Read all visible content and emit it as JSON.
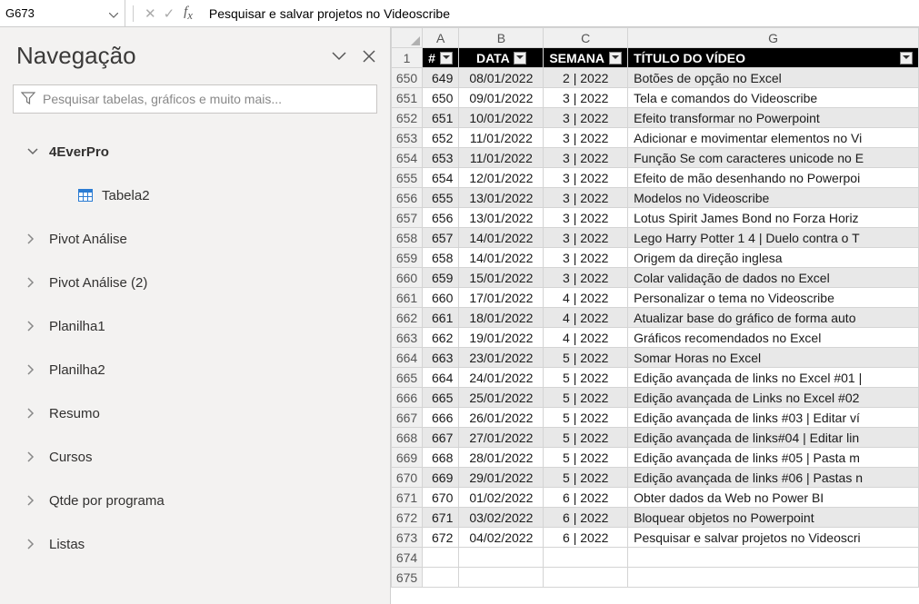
{
  "formula_bar": {
    "cell_ref": "G673",
    "formula": "Pesquisar e salvar projetos no Videoscribe"
  },
  "nav": {
    "title": "Navegação",
    "search_placeholder": "Pesquisar tabelas, gráficos e muito mais...",
    "tree": [
      {
        "label": "4EverPro",
        "bold": true,
        "expanded": true,
        "children": [
          {
            "label": "Tabela2",
            "icon": "table"
          }
        ]
      },
      {
        "label": "Pivot Análise",
        "bold": false,
        "expanded": false
      },
      {
        "label": "Pivot Análise (2)",
        "bold": false,
        "expanded": false
      },
      {
        "label": "Planilha1",
        "bold": false,
        "expanded": false
      },
      {
        "label": "Planilha2",
        "bold": false,
        "expanded": false
      },
      {
        "label": "Resumo",
        "bold": false,
        "expanded": false
      },
      {
        "label": "Cursos",
        "bold": false,
        "expanded": false
      },
      {
        "label": "Qtde por programa",
        "bold": false,
        "expanded": false
      },
      {
        "label": "Listas",
        "bold": false,
        "expanded": false
      }
    ]
  },
  "sheet": {
    "col_letters": [
      "A",
      "B",
      "C",
      "G"
    ],
    "header_row_num": "1",
    "headers": {
      "num": "#",
      "data": "DATA",
      "semana": "SEMANA",
      "titulo": "TÍTULO DO VÍDEO"
    },
    "rows": [
      {
        "r": "650",
        "n": "649",
        "d": "08/01/2022",
        "s": "2 | 2022",
        "t": "Botões de opção no Excel"
      },
      {
        "r": "651",
        "n": "650",
        "d": "09/01/2022",
        "s": "3 | 2022",
        "t": "Tela e comandos do Videoscribe"
      },
      {
        "r": "652",
        "n": "651",
        "d": "10/01/2022",
        "s": "3 | 2022",
        "t": "Efeito transformar no Powerpoint"
      },
      {
        "r": "653",
        "n": "652",
        "d": "11/01/2022",
        "s": "3 | 2022",
        "t": "Adicionar e movimentar elementos no Vi"
      },
      {
        "r": "654",
        "n": "653",
        "d": "11/01/2022",
        "s": "3 | 2022",
        "t": "Função Se com caracteres unicode no E"
      },
      {
        "r": "655",
        "n": "654",
        "d": "12/01/2022",
        "s": "3 | 2022",
        "t": "Efeito de mão desenhando no Powerpoi"
      },
      {
        "r": "656",
        "n": "655",
        "d": "13/01/2022",
        "s": "3 | 2022",
        "t": "Modelos no Videoscribe"
      },
      {
        "r": "657",
        "n": "656",
        "d": "13/01/2022",
        "s": "3 | 2022",
        "t": "Lotus Spirit James Bond no Forza Horiz"
      },
      {
        "r": "658",
        "n": "657",
        "d": "14/01/2022",
        "s": "3 | 2022",
        "t": "Lego Harry Potter 1 4 | Duelo contra o T"
      },
      {
        "r": "659",
        "n": "658",
        "d": "14/01/2022",
        "s": "3 | 2022",
        "t": "Origem da direção inglesa"
      },
      {
        "r": "660",
        "n": "659",
        "d": "15/01/2022",
        "s": "3 | 2022",
        "t": "Colar validação de dados no Excel"
      },
      {
        "r": "661",
        "n": "660",
        "d": "17/01/2022",
        "s": "4 | 2022",
        "t": "Personalizar o tema no Videoscribe"
      },
      {
        "r": "662",
        "n": "661",
        "d": "18/01/2022",
        "s": "4 | 2022",
        "t": "Atualizar base do gráfico de forma auto"
      },
      {
        "r": "663",
        "n": "662",
        "d": "19/01/2022",
        "s": "4 | 2022",
        "t": "Gráficos recomendados no Excel"
      },
      {
        "r": "664",
        "n": "663",
        "d": "23/01/2022",
        "s": "5 | 2022",
        "t": "Somar Horas no Excel"
      },
      {
        "r": "665",
        "n": "664",
        "d": "24/01/2022",
        "s": "5 | 2022",
        "t": "Edição avançada de links no Excel #01 |"
      },
      {
        "r": "666",
        "n": "665",
        "d": "25/01/2022",
        "s": "5 | 2022",
        "t": "Edição avançada de Links no Excel #02"
      },
      {
        "r": "667",
        "n": "666",
        "d": "26/01/2022",
        "s": "5 | 2022",
        "t": "Edição avançada de links #03 | Editar ví"
      },
      {
        "r": "668",
        "n": "667",
        "d": "27/01/2022",
        "s": "5 | 2022",
        "t": "Edição avançada de links#04 | Editar lin"
      },
      {
        "r": "669",
        "n": "668",
        "d": "28/01/2022",
        "s": "5 | 2022",
        "t": "Edição avançada de links #05 | Pasta m"
      },
      {
        "r": "670",
        "n": "669",
        "d": "29/01/2022",
        "s": "5 | 2022",
        "t": "Edição avançada de links #06 | Pastas n"
      },
      {
        "r": "671",
        "n": "670",
        "d": "01/02/2022",
        "s": "6 | 2022",
        "t": "Obter dados da Web no Power BI"
      },
      {
        "r": "672",
        "n": "671",
        "d": "03/02/2022",
        "s": "6 | 2022",
        "t": "Bloquear objetos no Powerpoint"
      },
      {
        "r": "673",
        "n": "672",
        "d": "04/02/2022",
        "s": "6 | 2022",
        "t": "Pesquisar e salvar projetos no Videoscri"
      }
    ],
    "empty_rows": [
      "674",
      "675"
    ]
  }
}
